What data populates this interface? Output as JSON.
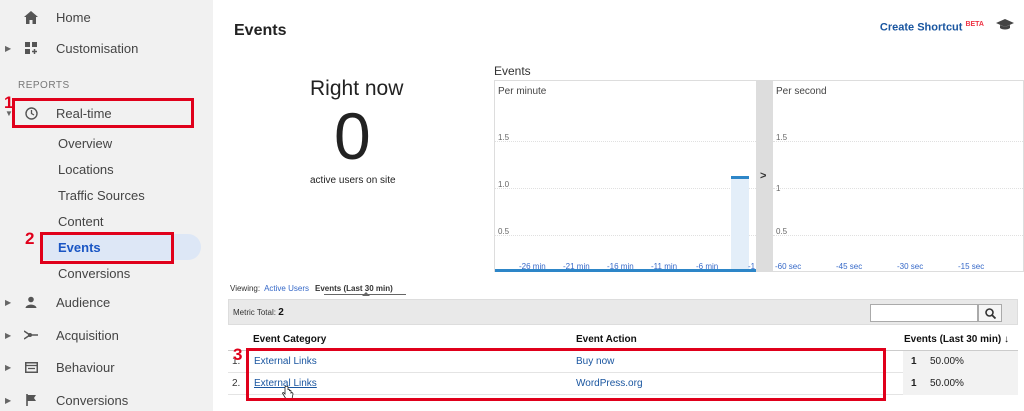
{
  "sidebar": {
    "home": "Home",
    "customisation": "Customisation",
    "reports_header": "REPORTS",
    "realtime": "Real-time",
    "realtime_sub": [
      "Overview",
      "Locations",
      "Traffic Sources",
      "Content",
      "Events",
      "Conversions"
    ],
    "audience": "Audience",
    "acquisition": "Acquisition",
    "behaviour": "Behaviour",
    "conversions": "Conversions"
  },
  "annotations": {
    "n1": "1",
    "n2": "2",
    "n3": "3"
  },
  "header": {
    "title": "Events",
    "shortcut": "Create Shortcut",
    "beta": "BETA"
  },
  "right_now": {
    "title": "Right now",
    "count": "0",
    "subtitle": "active users on site"
  },
  "events_chart": {
    "title": "Events",
    "per_minute": "Per minute",
    "per_second": "Per second",
    "y_ticks": [
      "1.5",
      "1.0",
      "0.5"
    ],
    "y_ticks_right": [
      "1.5",
      "1",
      "0.5"
    ],
    "x_ticks_min": [
      "-26 min",
      "-21 min",
      "-16 min",
      "-11 min",
      "-6 min",
      "-1"
    ],
    "x_ticks_sec": [
      "-60 sec",
      "-45 sec",
      "-30 sec",
      "-15 sec"
    ],
    "expand_arrow": ">"
  },
  "viewing": {
    "label": "Viewing:",
    "active_users": "Active Users",
    "current": "Events (Last 30 min)"
  },
  "metric": {
    "label": "Metric Total:",
    "value": "2"
  },
  "table": {
    "col_category": "Event Category",
    "col_action": "Event Action",
    "col_events": "Events (Last 30 min)",
    "sort_arrow": "↓",
    "rows": [
      {
        "num": "1.",
        "category": "External Links",
        "action": "Buy now",
        "count": "1",
        "pct": "50.00%"
      },
      {
        "num": "2.",
        "category": "External Links",
        "action": "WordPress.org",
        "count": "1",
        "pct": "50.00%"
      }
    ]
  },
  "colors": {
    "annotation": "#e0001b",
    "link": "#1a56a0",
    "active_nav": "#1a56c4",
    "bar": "#2d86c8"
  }
}
